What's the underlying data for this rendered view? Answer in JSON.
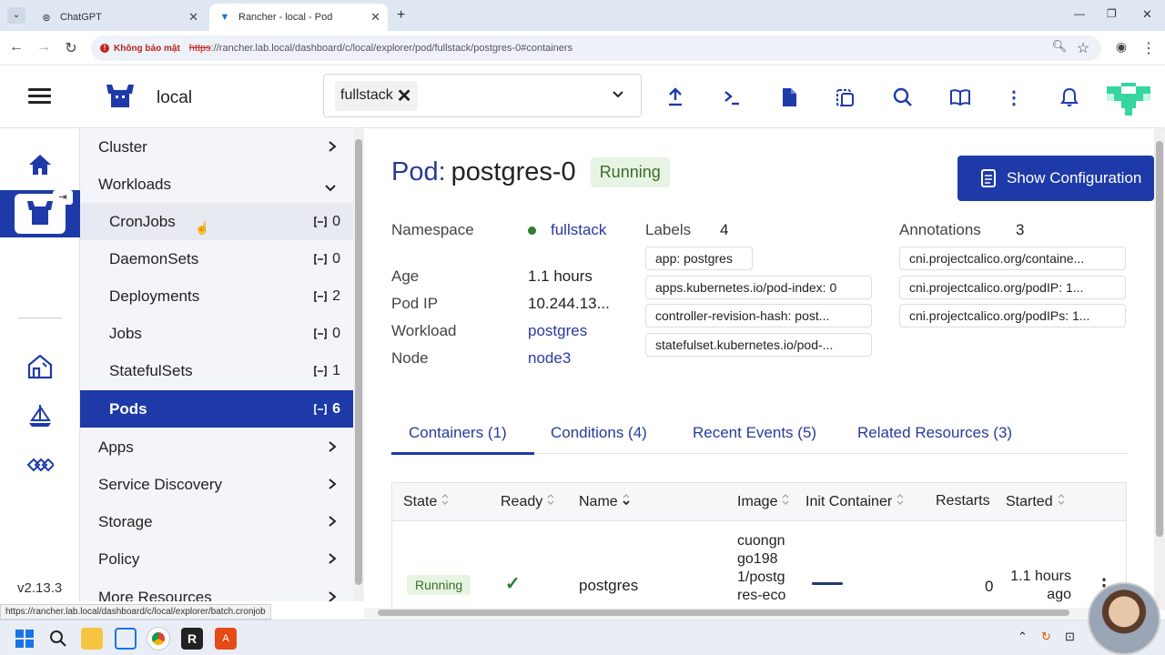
{
  "browser": {
    "tabs": [
      {
        "title": "ChatGPT",
        "icon": "chatgpt-icon"
      },
      {
        "title": "Rancher - local - Pod",
        "icon": "rancher-icon"
      }
    ],
    "security_label": "Không bảo mật",
    "url_scheme": "https",
    "url_rest": "://rancher.lab.local/dashboard/c/local/explorer/pod/fullstack/postgres-0#containers",
    "status_url": "https://rancher.lab.local/dashboard/c/local/explorer/batch.cronjob"
  },
  "header": {
    "cluster_name": "local",
    "namespace_filter": "fullstack"
  },
  "rail": {
    "version": "v2.13.3"
  },
  "sidenav": {
    "groups": [
      {
        "label": "Cluster"
      },
      {
        "label": "Workloads"
      },
      {
        "label": "Apps"
      },
      {
        "label": "Service Discovery"
      },
      {
        "label": "Storage"
      },
      {
        "label": "Policy"
      },
      {
        "label": "More Resources"
      }
    ],
    "workloads": [
      {
        "label": "CronJobs",
        "count": "0"
      },
      {
        "label": "DaemonSets",
        "count": "0"
      },
      {
        "label": "Deployments",
        "count": "2"
      },
      {
        "label": "Jobs",
        "count": "0"
      },
      {
        "label": "StatefulSets",
        "count": "1"
      },
      {
        "label": "Pods",
        "count": "6"
      }
    ]
  },
  "pod": {
    "kind_label": "Pod:",
    "name": "postgres-0",
    "state": "Running",
    "show_config_label": "Show Configuration",
    "details": {
      "namespace_label": "Namespace",
      "namespace": "fullstack",
      "age_label": "Age",
      "age": "1.1 hours",
      "pod_ip_label": "Pod IP",
      "pod_ip": "10.244.13...",
      "workload_label": "Workload",
      "workload": "postgres",
      "node_label": "Node",
      "node": "node3"
    },
    "labels_title": "Labels",
    "labels_count": "4",
    "labels": [
      "app: postgres",
      "apps.kubernetes.io/pod-index: 0",
      "controller-revision-hash: post...",
      "statefulset.kubernetes.io/pod-..."
    ],
    "annotations_title": "Annotations",
    "annotations_count": "3",
    "annotations": [
      "cni.projectcalico.org/containe...",
      "cni.projectcalico.org/podIP: 1...",
      "cni.projectcalico.org/podIPs: 1..."
    ],
    "tabs": [
      {
        "label": "Containers (1)"
      },
      {
        "label": "Conditions (4)"
      },
      {
        "label": "Recent Events (5)"
      },
      {
        "label": "Related Resources (3)"
      }
    ],
    "table": {
      "headers": [
        "State",
        "Ready",
        "Name",
        "Image",
        "Init Container",
        "Restarts",
        "Started"
      ],
      "rows": [
        {
          "state": "Running",
          "ready": "✓",
          "name": "postgres",
          "image_lines": [
            "cuongn",
            "go198",
            "1/postg",
            "res-eco"
          ],
          "restarts": "0",
          "started_line1": "1.1 hours",
          "started_line2": "ago"
        }
      ]
    }
  }
}
